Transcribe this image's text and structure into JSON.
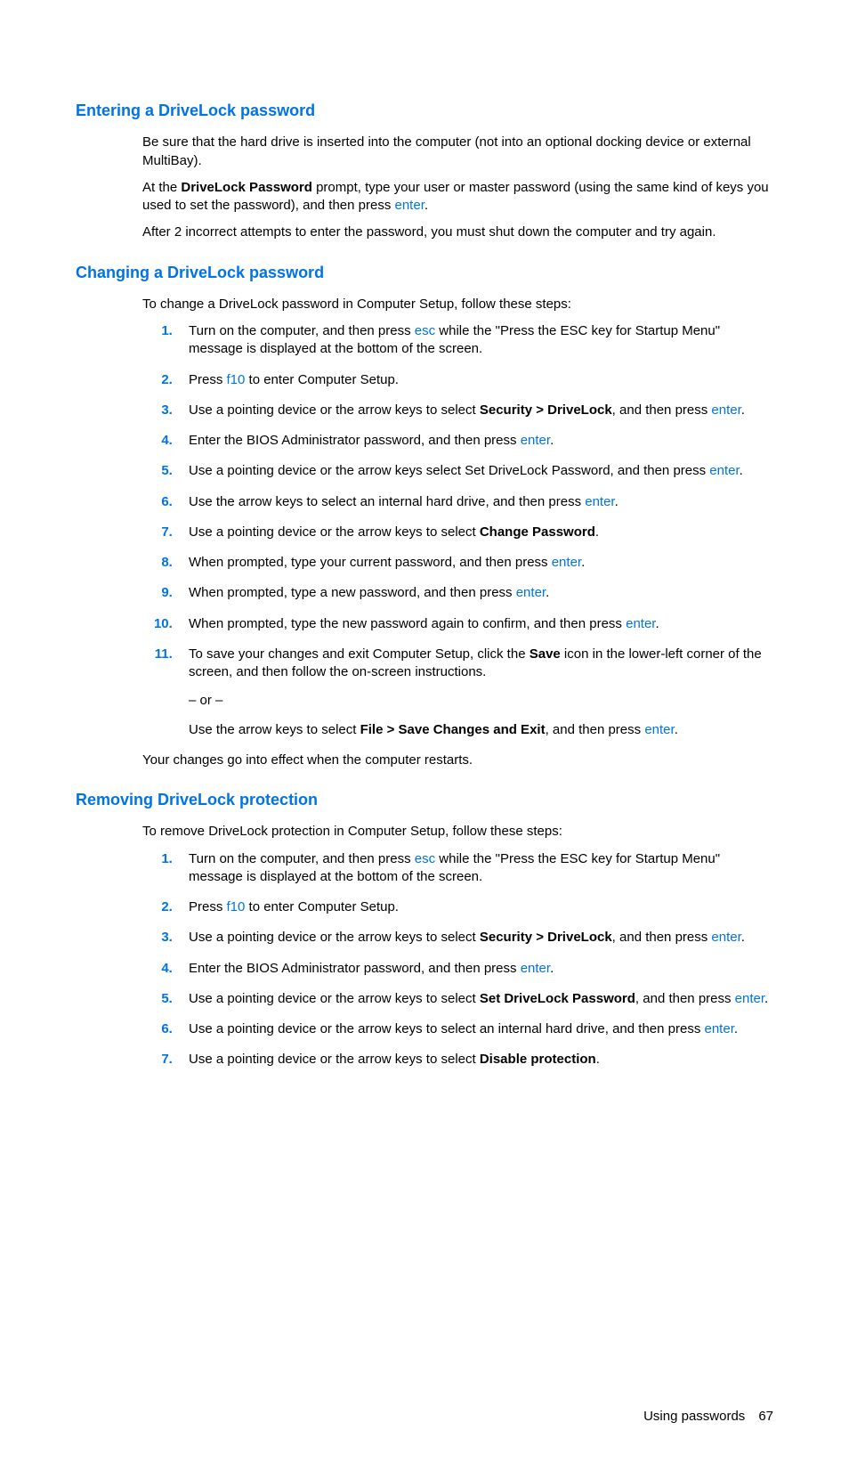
{
  "section1": {
    "heading": "Entering a DriveLock password",
    "p1": "Be sure that the hard drive is inserted into the computer (not into an optional docking device or external MultiBay).",
    "p2a": "At the ",
    "p2b": "DriveLock Password",
    "p2c": " prompt, type your user or master password (using the same kind of keys you used to set the password), and then press ",
    "p2d": "enter",
    "p2e": ".",
    "p3": "After 2 incorrect attempts to enter the password, you must shut down the computer and try again."
  },
  "section2": {
    "heading": "Changing a DriveLock password",
    "intro": "To change a DriveLock password in Computer Setup, follow these steps:",
    "steps": {
      "s1a": "Turn on the computer, and then press ",
      "s1b": "esc",
      "s1c": " while the \"Press the ESC key for Startup Menu\" message is displayed at the bottom of the screen.",
      "s2a": "Press ",
      "s2b": "f10",
      "s2c": " to enter Computer Setup.",
      "s3a": "Use a pointing device or the arrow keys to select ",
      "s3b": "Security > DriveLock",
      "s3c": ", and then press ",
      "s3d": "enter",
      "s3e": ".",
      "s4a": "Enter the BIOS Administrator password, and then press ",
      "s4b": "enter",
      "s4c": ".",
      "s5a": "Use a pointing device or the arrow keys select Set DriveLock Password, and then press ",
      "s5b": "enter",
      "s5c": ".",
      "s6a": "Use the arrow keys to select an internal hard drive, and then press ",
      "s6b": "enter",
      "s6c": ".",
      "s7a": "Use a pointing device or the arrow keys to select ",
      "s7b": "Change Password",
      "s7c": ".",
      "s8a": "When prompted, type your current password, and then press ",
      "s8b": "enter",
      "s8c": ".",
      "s9a": "When prompted, type a new password, and then press ",
      "s9b": "enter",
      "s9c": ".",
      "s10a": "When prompted, type the new password again to confirm, and then press ",
      "s10b": "enter",
      "s10c": ".",
      "s11a": "To save your changes and exit Computer Setup, click the ",
      "s11b": "Save",
      "s11c": " icon in the lower-left corner of the screen, and then follow the on-screen instructions.",
      "s11or": "– or –",
      "s11d": "Use the arrow keys to select ",
      "s11e": "File > Save Changes and Exit",
      "s11f": ", and then press ",
      "s11g": "enter",
      "s11h": "."
    },
    "outro": "Your changes go into effect when the computer restarts."
  },
  "section3": {
    "heading": "Removing DriveLock protection",
    "intro": "To remove DriveLock protection in Computer Setup, follow these steps:",
    "steps": {
      "s1a": "Turn on the computer, and then press ",
      "s1b": "esc",
      "s1c": " while the \"Press the ESC key for Startup Menu\" message is displayed at the bottom of the screen.",
      "s2a": "Press ",
      "s2b": "f10",
      "s2c": " to enter Computer Setup.",
      "s3a": "Use a pointing device or the arrow keys to select ",
      "s3b": "Security > DriveLock",
      "s3c": ", and then press ",
      "s3d": "enter",
      "s3e": ".",
      "s4a": "Enter the BIOS Administrator password, and then press ",
      "s4b": "enter",
      "s4c": ".",
      "s5a": "Use a pointing device or the arrow keys to select ",
      "s5b": "Set DriveLock Password",
      "s5c": ", and then press ",
      "s5d": "enter",
      "s5e": ".",
      "s6a": "Use a pointing device or the arrow keys to select an internal hard drive, and then press ",
      "s6b": "enter",
      "s6c": ".",
      "s7a": "Use a pointing device or the arrow keys to select ",
      "s7b": "Disable protection",
      "s7c": "."
    }
  },
  "footer": {
    "section": "Using passwords",
    "page": "67"
  }
}
